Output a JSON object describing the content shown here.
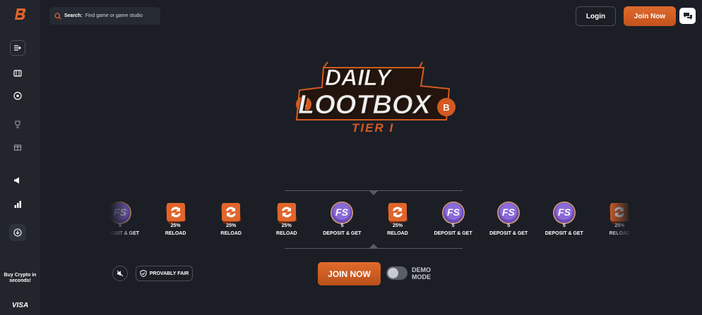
{
  "sidebar": {
    "buy_crypto": "Buy Crypto in seconds!",
    "visa": "VISA",
    "icons": [
      "menu-expand-icon",
      "slots-icon",
      "roulette-icon",
      "trophy-icon",
      "gift-icon",
      "megaphone-icon",
      "leaderboard-icon",
      "download-icon"
    ]
  },
  "header": {
    "search_label": "Search:",
    "search_placeholder": "Find game or game studio",
    "login": "Login",
    "join": "Join Now"
  },
  "title": {
    "line1": "DAILY",
    "line2": "LOOTBOX",
    "tier": "TIER I"
  },
  "carousel": {
    "items": [
      {
        "type": "fs",
        "value": "5",
        "name": "DEPOSIT & GET"
      },
      {
        "type": "reload",
        "value": "25%",
        "name": "RELOAD"
      },
      {
        "type": "reload",
        "value": "25%",
        "name": "RELOAD"
      },
      {
        "type": "reload",
        "value": "25%",
        "name": "RELOAD"
      },
      {
        "type": "fs",
        "value": "5",
        "name": "DEPOSIT & GET"
      },
      {
        "type": "reload",
        "value": "25%",
        "name": "RELOAD"
      },
      {
        "type": "fs",
        "value": "5",
        "name": "DEPOSIT & GET"
      },
      {
        "type": "fs",
        "value": "5",
        "name": "DEPOSIT & GET"
      },
      {
        "type": "fs",
        "value": "5",
        "name": "DEPOSIT & GET"
      },
      {
        "type": "reload",
        "value": "25%",
        "name": "RELOAD"
      }
    ]
  },
  "controls": {
    "provably_fair": "PROVABLY FAIR",
    "join_now": "JOIN NOW",
    "demo_mode": "DEMO MODE",
    "demo_on": false
  },
  "colors": {
    "accent": "#d9622a",
    "background": "#1b1e25",
    "sidebar": "#22252c",
    "fs_purple": "#7a5cc8"
  }
}
